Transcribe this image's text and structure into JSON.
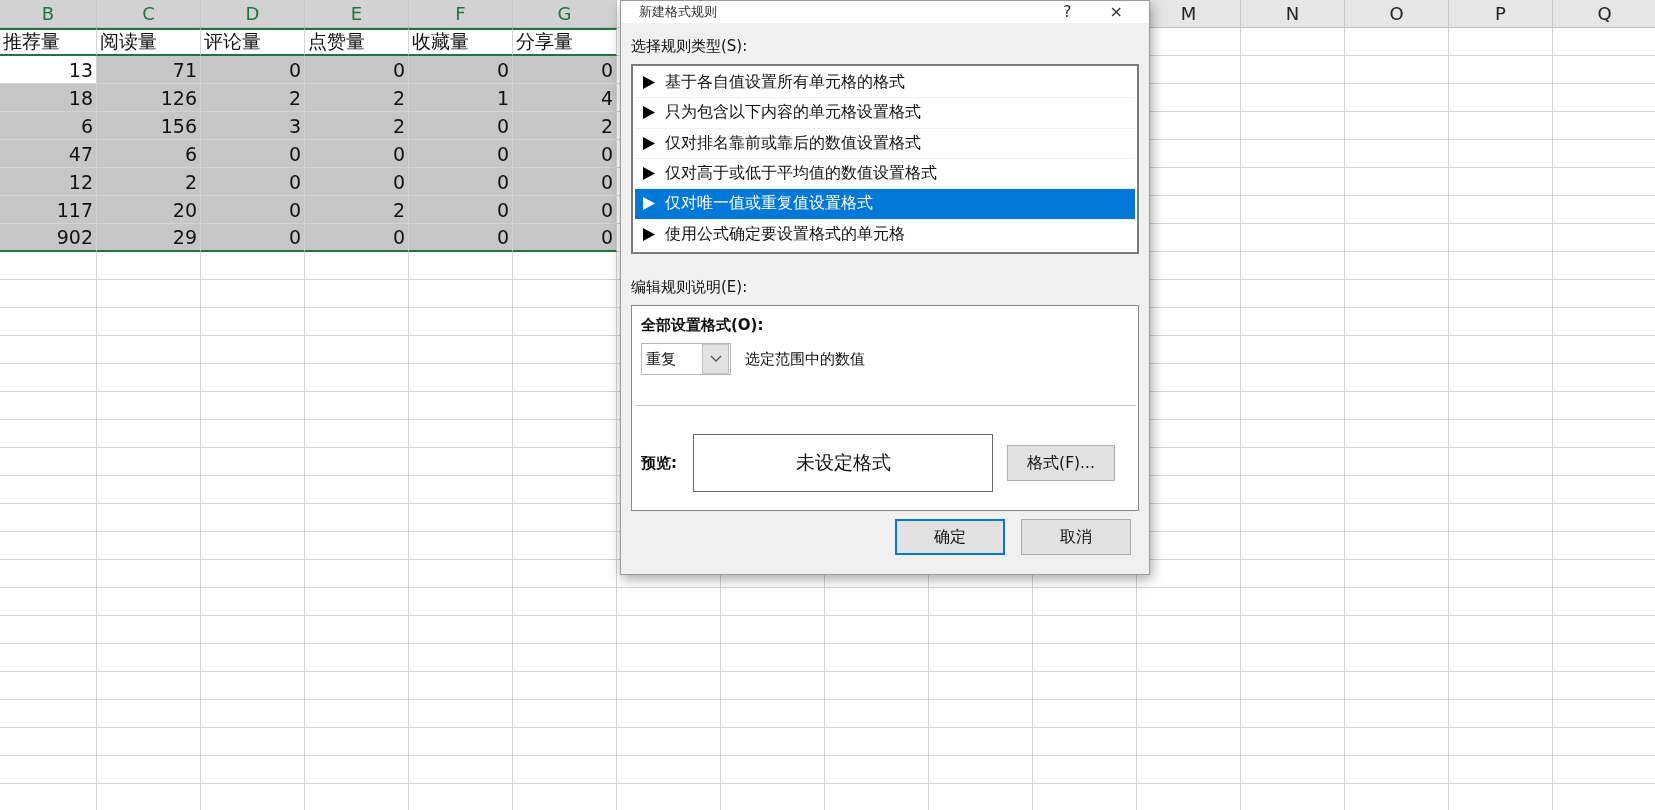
{
  "sheet": {
    "columns_left": [
      {
        "label": "B",
        "selected": true
      },
      {
        "label": "C",
        "selected": true
      },
      {
        "label": "D",
        "selected": true
      },
      {
        "label": "E",
        "selected": true
      },
      {
        "label": "F",
        "selected": true
      },
      {
        "label": "G",
        "selected": true
      }
    ],
    "columns_right": [
      {
        "label": "M",
        "selected": false
      },
      {
        "label": "N",
        "selected": false
      },
      {
        "label": "O",
        "selected": false
      },
      {
        "label": "P",
        "selected": false
      },
      {
        "label": "Q",
        "selected": false
      }
    ],
    "rows": [
      {
        "kind": "header",
        "cells": [
          {
            "text": "推荐量",
            "selected": false
          },
          {
            "text": "阅读量",
            "selected": false
          },
          {
            "text": "评论量",
            "selected": false
          },
          {
            "text": "点赞量",
            "selected": false
          },
          {
            "text": "收藏量",
            "selected": false
          },
          {
            "text": "分享量",
            "selected": false
          }
        ]
      },
      {
        "kind": "data",
        "cells": [
          {
            "text": "13",
            "selected": false
          },
          {
            "text": "71",
            "selected": true
          },
          {
            "text": "0",
            "selected": true
          },
          {
            "text": "0",
            "selected": true
          },
          {
            "text": "0",
            "selected": true
          },
          {
            "text": "0",
            "selected": true
          }
        ]
      },
      {
        "kind": "data",
        "cells": [
          {
            "text": "18",
            "selected": true
          },
          {
            "text": "126",
            "selected": true
          },
          {
            "text": "2",
            "selected": true
          },
          {
            "text": "2",
            "selected": true
          },
          {
            "text": "1",
            "selected": true
          },
          {
            "text": "4",
            "selected": true
          }
        ]
      },
      {
        "kind": "data",
        "cells": [
          {
            "text": "6",
            "selected": true
          },
          {
            "text": "156",
            "selected": true
          },
          {
            "text": "3",
            "selected": true
          },
          {
            "text": "2",
            "selected": true
          },
          {
            "text": "0",
            "selected": true
          },
          {
            "text": "2",
            "selected": true
          }
        ]
      },
      {
        "kind": "data",
        "cells": [
          {
            "text": "47",
            "selected": true
          },
          {
            "text": "6",
            "selected": true
          },
          {
            "text": "0",
            "selected": true
          },
          {
            "text": "0",
            "selected": true
          },
          {
            "text": "0",
            "selected": true
          },
          {
            "text": "0",
            "selected": true
          }
        ]
      },
      {
        "kind": "data",
        "cells": [
          {
            "text": "12",
            "selected": true
          },
          {
            "text": "2",
            "selected": true
          },
          {
            "text": "0",
            "selected": true
          },
          {
            "text": "0",
            "selected": true
          },
          {
            "text": "0",
            "selected": true
          },
          {
            "text": "0",
            "selected": true
          }
        ]
      },
      {
        "kind": "data",
        "cells": [
          {
            "text": "117",
            "selected": true
          },
          {
            "text": "20",
            "selected": true
          },
          {
            "text": "0",
            "selected": true
          },
          {
            "text": "2",
            "selected": true
          },
          {
            "text": "0",
            "selected": true
          },
          {
            "text": "0",
            "selected": true
          }
        ]
      },
      {
        "kind": "data",
        "cells": [
          {
            "text": "902",
            "selected": true
          },
          {
            "text": "29",
            "selected": true
          },
          {
            "text": "0",
            "selected": true
          },
          {
            "text": "0",
            "selected": true
          },
          {
            "text": "0",
            "selected": true
          },
          {
            "text": "0",
            "selected": true
          }
        ]
      }
    ]
  },
  "dialog": {
    "title": "新建格式规则",
    "help_button": "?",
    "close_button": "×",
    "rule_type_label": "选择规则类型(S):",
    "rule_types": [
      {
        "label": "基于各自值设置所有单元格的格式",
        "selected": false
      },
      {
        "label": "只为包含以下内容的单元格设置格式",
        "selected": false
      },
      {
        "label": "仅对排名靠前或靠后的数值设置格式",
        "selected": false
      },
      {
        "label": "仅对高于或低于平均值的数值设置格式",
        "selected": false
      },
      {
        "label": "仅对唯一值或重复值设置格式",
        "selected": true
      },
      {
        "label": "使用公式确定要设置格式的单元格",
        "selected": false
      }
    ],
    "description_label": "编辑规则说明(E):",
    "format_all_label": "全部设置格式(O):",
    "dropdown": {
      "value": "重复"
    },
    "dropdown_suffix": "选定范围中的数值",
    "preview_label": "预览:",
    "preview_text": "未设定格式",
    "format_button": "格式(F)...",
    "buttons": [
      {
        "label": "确定",
        "default": true
      },
      {
        "label": "取消",
        "default": false
      }
    ]
  }
}
